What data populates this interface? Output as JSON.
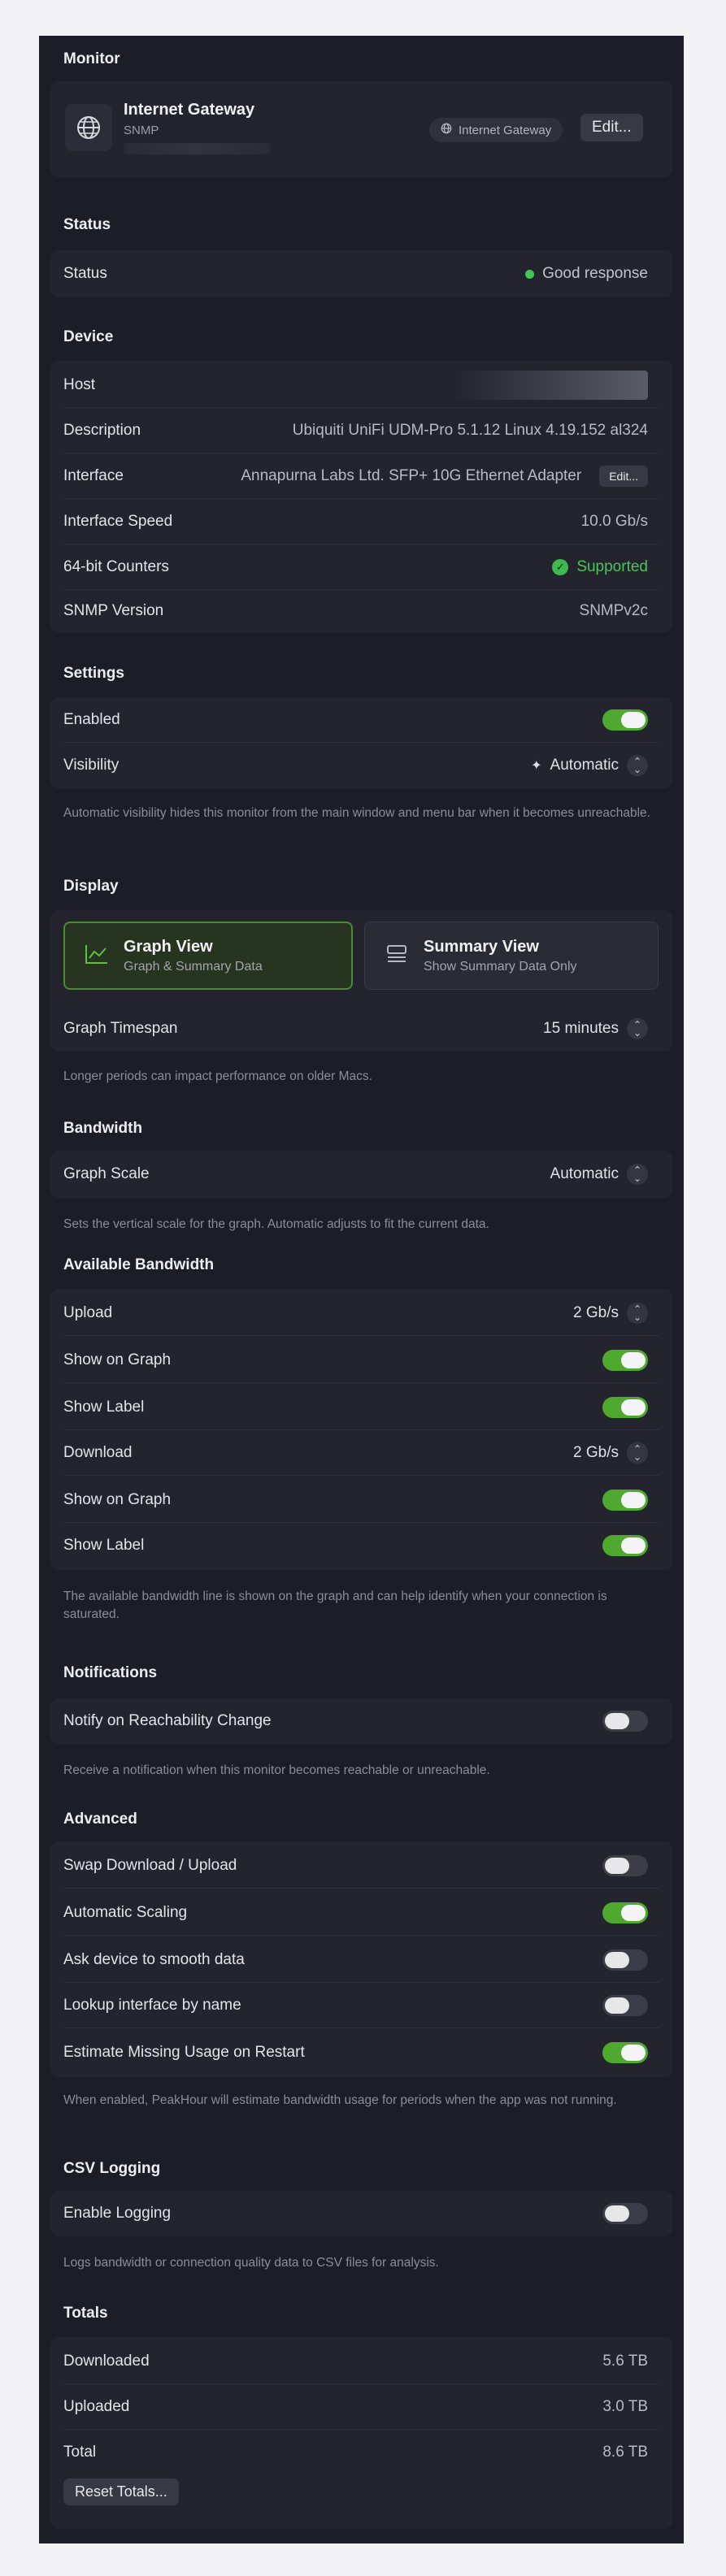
{
  "monitor": {
    "heading": "Monitor",
    "name": "Internet Gateway",
    "type": "SNMP",
    "badge": "Internet Gateway",
    "edit_label": "Edit...",
    "icon": "globe-icon"
  },
  "status": {
    "heading": "Status",
    "label": "Status",
    "value": "Good response",
    "color": "#44c55a"
  },
  "device": {
    "heading": "Device",
    "host_label": "Host",
    "description_label": "Description",
    "description_value": "Ubiquiti UniFi UDM-Pro 5.1.12 Linux 4.19.152 al324",
    "interface_label": "Interface",
    "interface_value": "Annapurna Labs Ltd. SFP+ 10G Ethernet Adapter",
    "interface_edit": "Edit...",
    "speed_label": "Interface Speed",
    "speed_value": "10.0 Gb/s",
    "counters_label": "64-bit Counters",
    "counters_value": "Supported",
    "snmp_label": "SNMP Version",
    "snmp_value": "SNMPv2c"
  },
  "settings": {
    "heading": "Settings",
    "enabled_label": "Enabled",
    "enabled": true,
    "visibility_label": "Visibility",
    "visibility_value": "Automatic",
    "note": "Automatic visibility hides this monitor from the main window and menu bar when it becomes unreachable."
  },
  "display": {
    "heading": "Display",
    "graph_view_title": "Graph View",
    "graph_view_sub": "Graph & Summary Data",
    "summary_view_title": "Summary View",
    "summary_view_sub": "Show Summary Data Only",
    "selected": "graph",
    "timespan_label": "Graph Timespan",
    "timespan_value": "15 minutes",
    "note": "Longer periods can impact performance on older Macs."
  },
  "bandwidth": {
    "heading": "Bandwidth",
    "scale_label": "Graph Scale",
    "scale_value": "Automatic",
    "note": "Sets the vertical scale for the graph. Automatic adjusts to fit the current data."
  },
  "available": {
    "heading": "Available Bandwidth",
    "upload_label": "Upload",
    "upload_value": "2 Gb/s",
    "show_graph_label": "Show on Graph",
    "show_label_label": "Show Label",
    "download_label": "Download",
    "download_value": "2 Gb/s",
    "note": "The available bandwidth line is shown on the graph and can help identify when your connection is saturated."
  },
  "notifications": {
    "heading": "Notifications",
    "reach_label": "Notify on Reachability Change",
    "reach": false,
    "note": "Receive a notification when this monitor becomes reachable or unreachable."
  },
  "advanced": {
    "heading": "Advanced",
    "swap_label": "Swap Download / Upload",
    "scaling_label": "Automatic Scaling",
    "smooth_label": "Ask device to smooth data",
    "lookup_label": "Lookup interface by name",
    "estimate_label": "Estimate Missing Usage on Restart",
    "note": "When enabled, PeakHour will estimate bandwidth usage for periods when the app was not running."
  },
  "csv": {
    "heading": "CSV Logging",
    "enable_label": "Enable Logging",
    "note": "Logs bandwidth or connection quality data to CSV files for analysis."
  },
  "totals": {
    "heading": "Totals",
    "downloaded_label": "Downloaded",
    "downloaded_value": "5.6 TB",
    "uploaded_label": "Uploaded",
    "uploaded_value": "3.0 TB",
    "total_label": "Total",
    "total_value": "8.6 TB",
    "reset_label": "Reset Totals..."
  },
  "colors": {
    "accent_green": "#4ea92e",
    "background": "#1c1d26"
  }
}
